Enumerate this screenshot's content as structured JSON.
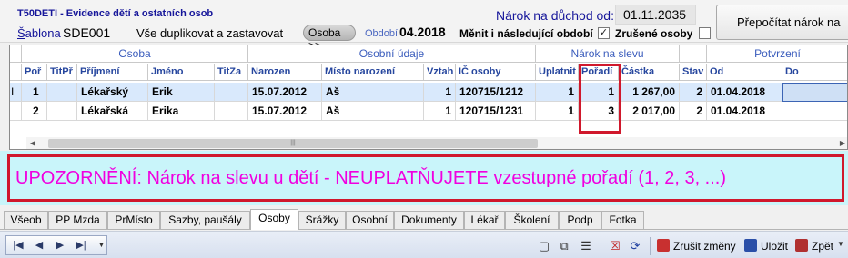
{
  "header": {
    "module_title": "T50DETI - Evidence dětí a ostatních osob",
    "narok_label": "Nárok na důchod od:",
    "narok_value": "01.11.2035",
    "recalc_button": "Přepočítat nárok na",
    "sablona_label_u": "Š",
    "sablona_label_rest": "ablona",
    "sablona_code": "SDE001",
    "sablona_desc": "Vše duplikovat a zastavovat",
    "osoba_button": "Osoba >>",
    "obdobi_label": "Období",
    "obdobi_value": "04.2018",
    "menit_label": "Měnit i následující období",
    "menit_checked": "✓",
    "zrusene_label": "Zrušené osoby"
  },
  "grid": {
    "groups": [
      "Osoba",
      "Osobní údaje",
      "Nárok na slevu",
      "Potvrzení"
    ],
    "columns": [
      "Poř",
      "TitPř",
      "Příjmení",
      "Jméno",
      "TitZa",
      "Narozen",
      "Místo narození",
      "Vztah",
      "IČ osoby",
      "Uplatnit",
      "Pořadí",
      "Částka",
      "Stav",
      "Od",
      "Do"
    ],
    "rows": [
      {
        "indicator": "I",
        "por": "1",
        "titpr": "",
        "prijmeni": "Lékařský",
        "jmeno": "Erik",
        "titza": "",
        "narozen": "15.07.2012",
        "misto": "Aš",
        "vztah": "1",
        "ic": "120715/1212",
        "uplatnit": "1",
        "poradi": "1",
        "castka": "1 267,00",
        "stav": "2",
        "od": "01.04.2018",
        "do": ""
      },
      {
        "indicator": "",
        "por": "2",
        "titpr": "",
        "prijmeni": "Lékařská",
        "jmeno": "Erika",
        "titza": "",
        "narozen": "15.07.2012",
        "misto": "Aš",
        "vztah": "1",
        "ic": "120715/1231",
        "uplatnit": "1",
        "poradi": "3",
        "castka": "2 017,00",
        "stav": "2",
        "od": "01.04.2018",
        "do": ""
      }
    ]
  },
  "warning": "UPOZORNĚNÍ:  Nárok na slevu u dětí -  NEUPLATŇUJETE vzestupné pořadí (1, 2, 3, ...)",
  "tabs": [
    {
      "label": "Všeob"
    },
    {
      "label": "PP Mzda"
    },
    {
      "label": "PrMísto"
    },
    {
      "label": "Sazby, paušály"
    },
    {
      "label": "Osoby",
      "active": true
    },
    {
      "label": "Srážky"
    },
    {
      "label": "Osobní"
    },
    {
      "label": "Dokumenty"
    },
    {
      "label": "Lékař"
    },
    {
      "label": "Školení"
    },
    {
      "label": "Podp"
    },
    {
      "label": "Fotka"
    }
  ],
  "toolbar": {
    "cancel_label": "Zrušit změny",
    "save_label": "Uložit",
    "back_label": "Zpět"
  },
  "colors": {
    "accent_blue": "#16169a",
    "warning_text": "#f000e0",
    "warning_border": "#d0182c",
    "warning_bg": "#c9f5fa",
    "selected_row": "#d9e9fc"
  }
}
